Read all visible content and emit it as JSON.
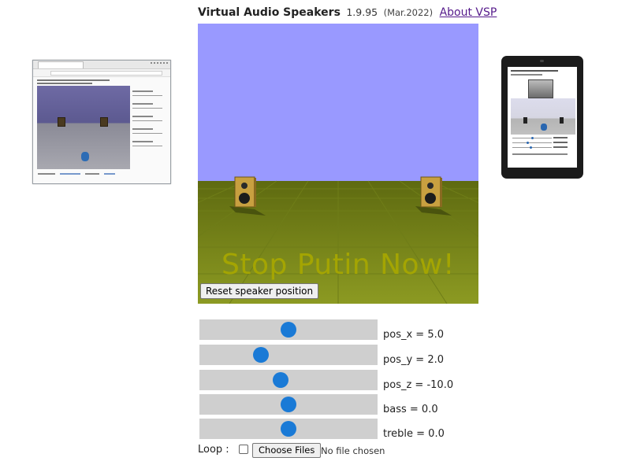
{
  "header": {
    "app_name": "Virtual Audio Speakers",
    "version": "1.9.95",
    "date": "(Mar.2022)",
    "about_link": "About VSP"
  },
  "scene": {
    "overlay_text": "Stop Putin Now!",
    "reset_button": "Reset speaker position",
    "colors": {
      "sky": "#9999ff",
      "floor": "#7a8a18",
      "overlay_text": "#a8a800"
    }
  },
  "sliders": [
    {
      "name": "pos_x",
      "label": "pos_x = 5.0",
      "value": 5.0,
      "fraction": 0.5
    },
    {
      "name": "pos_y",
      "label": "pos_y = 2.0",
      "value": 2.0,
      "fraction": 0.33
    },
    {
      "name": "pos_z",
      "label": "pos_z = -10.0",
      "value": -10.0,
      "fraction": 0.45
    },
    {
      "name": "bass",
      "label": "bass = 0.0",
      "value": 0.0,
      "fraction": 0.5
    },
    {
      "name": "treble",
      "label": "treble = 0.0",
      "value": 0.0,
      "fraction": 0.5
    }
  ],
  "controls": {
    "loop_label": "Loop :",
    "loop_checked": false,
    "choose_files": "Choose Files",
    "file_status": "No file chosen"
  },
  "accent": "#1a7ad6"
}
